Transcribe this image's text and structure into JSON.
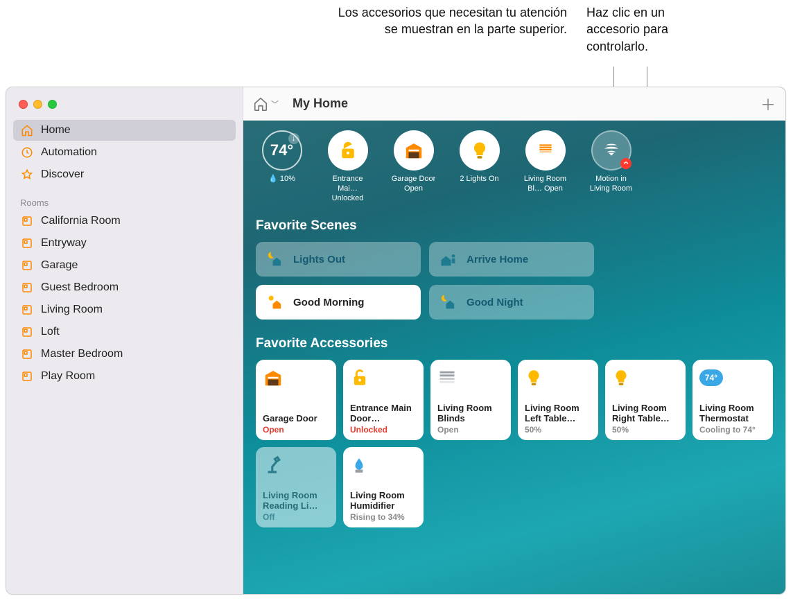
{
  "callouts": {
    "attention": "Los accesorios que necesitan tu atención se muestran en la parte superior.",
    "click": "Haz clic en un accesorio para controlarlo."
  },
  "sidebar": {
    "primary": [
      {
        "label": "Home",
        "icon": "home"
      },
      {
        "label": "Automation",
        "icon": "clock"
      },
      {
        "label": "Discover",
        "icon": "star"
      }
    ],
    "rooms_header": "Rooms",
    "rooms": [
      {
        "label": "California Room"
      },
      {
        "label": "Entryway"
      },
      {
        "label": "Garage"
      },
      {
        "label": "Guest Bedroom"
      },
      {
        "label": "Living Room"
      },
      {
        "label": "Loft"
      },
      {
        "label": "Master Bedroom"
      },
      {
        "label": "Play Room"
      }
    ]
  },
  "titlebar": {
    "title": "My Home"
  },
  "status": {
    "weather": {
      "temp": "74°",
      "rain": "10%",
      "label": ""
    },
    "items": [
      {
        "label": "Entrance Mai… Unlocked",
        "kind": "lock"
      },
      {
        "label": "Garage Door Open",
        "kind": "garage"
      },
      {
        "label": "2 Lights On",
        "kind": "bulb"
      },
      {
        "label": "Living Room Bl… Open",
        "kind": "blinds"
      },
      {
        "label": "Motion in Living Room",
        "kind": "motion"
      }
    ]
  },
  "sections": {
    "scenes": "Favorite Scenes",
    "accessories": "Favorite Accessories"
  },
  "scenes": [
    {
      "label": "Lights Out",
      "on": false,
      "icon": "moon-house"
    },
    {
      "label": "Arrive Home",
      "on": false,
      "icon": "person-house"
    },
    {
      "label": "Good Morning",
      "on": true,
      "icon": "sun-house"
    },
    {
      "label": "Good Night",
      "on": false,
      "icon": "moon-house"
    }
  ],
  "accessories": [
    {
      "name": "Garage Door",
      "sub": "Open",
      "subclass": "red",
      "icon": "garage",
      "dim": false
    },
    {
      "name": "Entrance Main Door…",
      "sub": "Unlocked",
      "subclass": "red",
      "icon": "lock",
      "dim": false
    },
    {
      "name": "Living Room Blinds",
      "sub": "Open",
      "subclass": "grey",
      "icon": "blinds",
      "dim": false
    },
    {
      "name": "Living Room Left Table…",
      "sub": "50%",
      "subclass": "grey",
      "icon": "bulb",
      "dim": false
    },
    {
      "name": "Living Room Right Table…",
      "sub": "50%",
      "subclass": "grey",
      "icon": "bulb",
      "dim": false
    },
    {
      "name": "Living Room Thermostat",
      "sub": "Cooling to 74°",
      "subclass": "grey",
      "icon": "thermostat",
      "temp": "74°",
      "dim": false
    },
    {
      "name": "Living Room Reading Li…",
      "sub": "Off",
      "subclass": "teal",
      "icon": "desklamp",
      "dim": true
    },
    {
      "name": "Living Room Humidifier",
      "sub": "Rising to 34%",
      "subclass": "grey",
      "icon": "humidifier",
      "dim": false
    }
  ],
  "colors": {
    "accent_orange": "#ff8a00",
    "alert_red": "#ff3b30",
    "thermostat_blue": "#3aa7e6"
  }
}
